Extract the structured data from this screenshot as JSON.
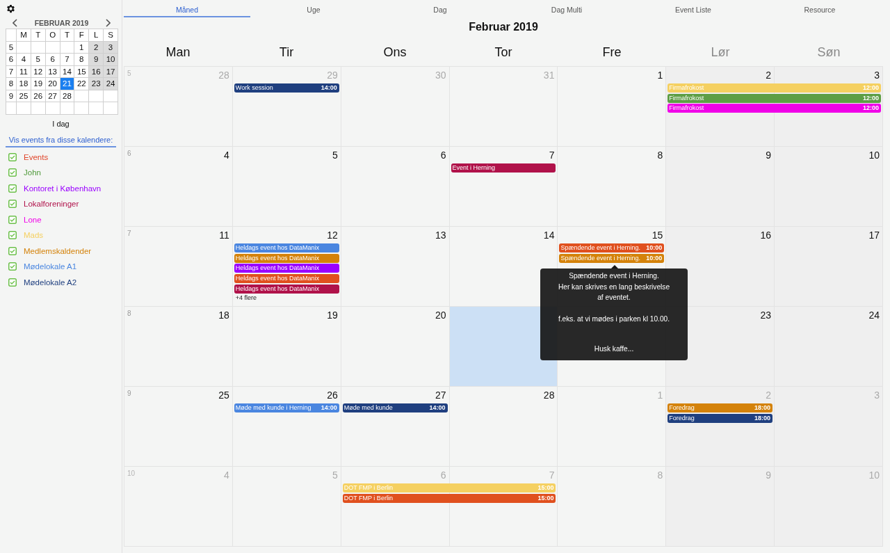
{
  "sidebar": {
    "mini_calendar": {
      "title": "FEBRUAR 2019",
      "weekdays": [
        "M",
        "T",
        "O",
        "T",
        "F",
        "L",
        "S"
      ],
      "weeks": [
        {
          "week": "5",
          "days": [
            {
              "day": "1",
              "selected": false
            },
            {
              "day": "2",
              "selected": false
            },
            {
              "day": "3",
              "selected": false
            }
          ]
        },
        {
          "week": "6",
          "days": [
            {
              "day": "4",
              "selected": false
            },
            {
              "day": "5",
              "selected": false
            },
            {
              "day": "6",
              "selected": false
            },
            {
              "day": "7",
              "selected": false
            },
            {
              "day": "8",
              "selected": false
            },
            {
              "day": "9",
              "selected": false
            },
            {
              "day": "10",
              "selected": false
            }
          ]
        },
        {
          "week": "7",
          "days": [
            {
              "day": "11",
              "selected": false
            },
            {
              "day": "12",
              "selected": false
            },
            {
              "day": "13",
              "selected": false
            },
            {
              "day": "14",
              "selected": false
            },
            {
              "day": "15",
              "selected": false
            },
            {
              "day": "16",
              "selected": false
            },
            {
              "day": "17",
              "selected": false
            }
          ]
        },
        {
          "week": "8",
          "days": [
            {
              "day": "18",
              "selected": false
            },
            {
              "day": "19",
              "selected": false
            },
            {
              "day": "20",
              "selected": false
            },
            {
              "day": "21",
              "selected": true
            },
            {
              "day": "22",
              "selected": false
            },
            {
              "day": "23",
              "selected": false
            },
            {
              "day": "24",
              "selected": false
            }
          ]
        },
        {
          "week": "9",
          "days": [
            {
              "day": "25",
              "selected": false
            },
            {
              "day": "26",
              "selected": false
            },
            {
              "day": "27",
              "selected": false
            },
            {
              "day": "28",
              "selected": false
            }
          ]
        }
      ],
      "today_label": "I dag"
    },
    "calendars_heading": "Vis events fra disse kalendere:",
    "calendars": [
      {
        "name": "Events",
        "color": "#e0452a",
        "checked": true
      },
      {
        "name": "John",
        "color": "#4f9a3a",
        "checked": true
      },
      {
        "name": "Kontoret i København",
        "color": "#9a00ff",
        "checked": true
      },
      {
        "name": "Lokalforeninger",
        "color": "#b0124a",
        "checked": true
      },
      {
        "name": "Lone",
        "color": "#f000e8",
        "checked": true
      },
      {
        "name": "Mads",
        "color": "#f5d060",
        "checked": true
      },
      {
        "name": "Medlemskaldender",
        "color": "#d4820a",
        "checked": true
      },
      {
        "name": "Mødelokale A1",
        "color": "#4a86e0",
        "checked": true
      },
      {
        "name": "Mødelokale A2",
        "color": "#1f3f7f",
        "checked": true
      }
    ]
  },
  "tabs": [
    {
      "label": "Måned",
      "selected": true
    },
    {
      "label": "Uge",
      "selected": false
    },
    {
      "label": "Dag",
      "selected": false
    },
    {
      "label": "Dag Multi",
      "selected": false
    },
    {
      "label": "Event Liste",
      "selected": false
    },
    {
      "label": "Resource",
      "selected": false
    }
  ],
  "month_title": "Februar 2019",
  "weekday_headers": [
    {
      "label": "Man",
      "weekend": false
    },
    {
      "label": "Tir",
      "weekend": false
    },
    {
      "label": "Ons",
      "weekend": false
    },
    {
      "label": "Tor",
      "weekend": false
    },
    {
      "label": "Fre",
      "weekend": false
    },
    {
      "label": "Lør",
      "weekend": true
    },
    {
      "label": "Søn",
      "weekend": true
    }
  ],
  "weeks": [
    {
      "week": "5",
      "days": [
        {
          "day": "28",
          "other_month": true
        },
        {
          "day": "29",
          "other_month": true,
          "events": [
            {
              "title": "Work session",
              "time": "14:00",
              "color": "#1f3f7f",
              "continues": false
            }
          ]
        },
        {
          "day": "30",
          "other_month": true
        },
        {
          "day": "31",
          "other_month": true
        },
        {
          "day": "1",
          "other_month": false
        },
        {
          "day": "2",
          "other_month": false,
          "events": [
            {
              "title": "Firmafrokost",
              "time": "12:00",
              "color": "#f5d060",
              "continues": true
            },
            {
              "title": "Firmafrokost",
              "time": "12:00",
              "color": "#5e9e45",
              "continues": true
            },
            {
              "title": "Firmafrokost",
              "time": "12:00",
              "color": "#f000e8",
              "continues": true
            }
          ]
        },
        {
          "day": "3",
          "other_month": false
        }
      ]
    },
    {
      "week": "6",
      "days": [
        {
          "day": "4",
          "other_month": false
        },
        {
          "day": "5",
          "other_month": false
        },
        {
          "day": "6",
          "other_month": false
        },
        {
          "day": "7",
          "other_month": false,
          "events": [
            {
              "title": "Event i Herning",
              "color": "#b0124a",
              "continues": false
            }
          ]
        },
        {
          "day": "8",
          "other_month": false
        },
        {
          "day": "9",
          "other_month": false
        },
        {
          "day": "10",
          "other_month": false
        }
      ]
    },
    {
      "week": "7",
      "days": [
        {
          "day": "11",
          "other_month": false
        },
        {
          "day": "12",
          "other_month": false,
          "events": [
            {
              "title": "Heldags event hos DataManix",
              "color": "#4a86e0",
              "continues": false
            },
            {
              "title": "Heldags event hos DataManix",
              "color": "#d4820a",
              "continues": false
            },
            {
              "title": "Heldags event hos DataManix",
              "color": "#9a00ff",
              "continues": false
            },
            {
              "title": "Heldags event hos DataManix",
              "color": "#e0501e",
              "continues": false
            },
            {
              "title": "Heldags event hos DataManix",
              "color": "#b0124a",
              "continues": false
            }
          ],
          "more": "+4 flere"
        },
        {
          "day": "13",
          "other_month": false
        },
        {
          "day": "14",
          "other_month": false
        },
        {
          "day": "15",
          "other_month": false,
          "events": [
            {
              "title": "Spændende event i Herning.",
              "time": "10:00",
              "color": "#e0501e",
              "continues": false
            },
            {
              "title": "Spændende event i Herning.",
              "time": "10:00",
              "color": "#d4820a",
              "continues": false
            }
          ]
        },
        {
          "day": "16",
          "other_month": false
        },
        {
          "day": "17",
          "other_month": false
        }
      ]
    },
    {
      "week": "8",
      "days": [
        {
          "day": "18",
          "other_month": false
        },
        {
          "day": "19",
          "other_month": false
        },
        {
          "day": "20",
          "other_month": false
        },
        {
          "today": true
        },
        {
          "today": false
        },
        {
          "day": "23",
          "other_month": false
        },
        {
          "day": "24",
          "other_month": false
        }
      ]
    },
    {
      "week": "9",
      "days": [
        {
          "day": "25",
          "other_month": false
        },
        {
          "day": "26",
          "other_month": false,
          "events": [
            {
              "title": "Møde med kunde i Herning",
              "time": "14:00",
              "color": "#4a86e0",
              "continues": false
            }
          ]
        },
        {
          "day": "27",
          "other_month": false,
          "events": [
            {
              "title": "Møde med kunde",
              "time": "14:00",
              "color": "#1f3f7f",
              "continues": false
            }
          ]
        },
        {
          "day": "28",
          "other_month": false
        },
        {
          "day": "1",
          "other_month": true
        },
        {
          "day": "2",
          "other_month": true,
          "events": [
            {
              "title": "Foredrag",
              "time": "18:00",
              "color": "#d4820a",
              "continues": false
            },
            {
              "title": "Foredrag",
              "time": "18:00",
              "color": "#1f3f7f",
              "continues": false
            }
          ]
        },
        {
          "day": "3",
          "other_month": true
        }
      ]
    },
    {
      "week": "10",
      "days": [
        {
          "day": "4",
          "other_month": true
        },
        {
          "day": "5",
          "other_month": true
        },
        {
          "day": "6",
          "other_month": true,
          "events": [
            {
              "title": "DOT FMP i Berlin",
              "time": "15:00",
              "color": "#f5d060",
              "continues": true
            },
            {
              "title": "DOT FMP i Berlin",
              "time": "15:00",
              "color": "#e0501e",
              "continues": true
            }
          ]
        },
        {
          "day": "7",
          "other_month": true
        },
        {
          "day": "8",
          "other_month": true
        },
        {
          "day": "9",
          "other_month": true
        },
        {
          "day": "10",
          "other_month": true
        }
      ]
    }
  ],
  "tooltip": {
    "paragraphs": [
      "Spændende event i Herning.\nHer kan skrives en lang beskrivelse\naf eventet.",
      "f.eks. at vi mødes i parken kl 10.00.",
      "Husk kaffe..."
    ]
  }
}
